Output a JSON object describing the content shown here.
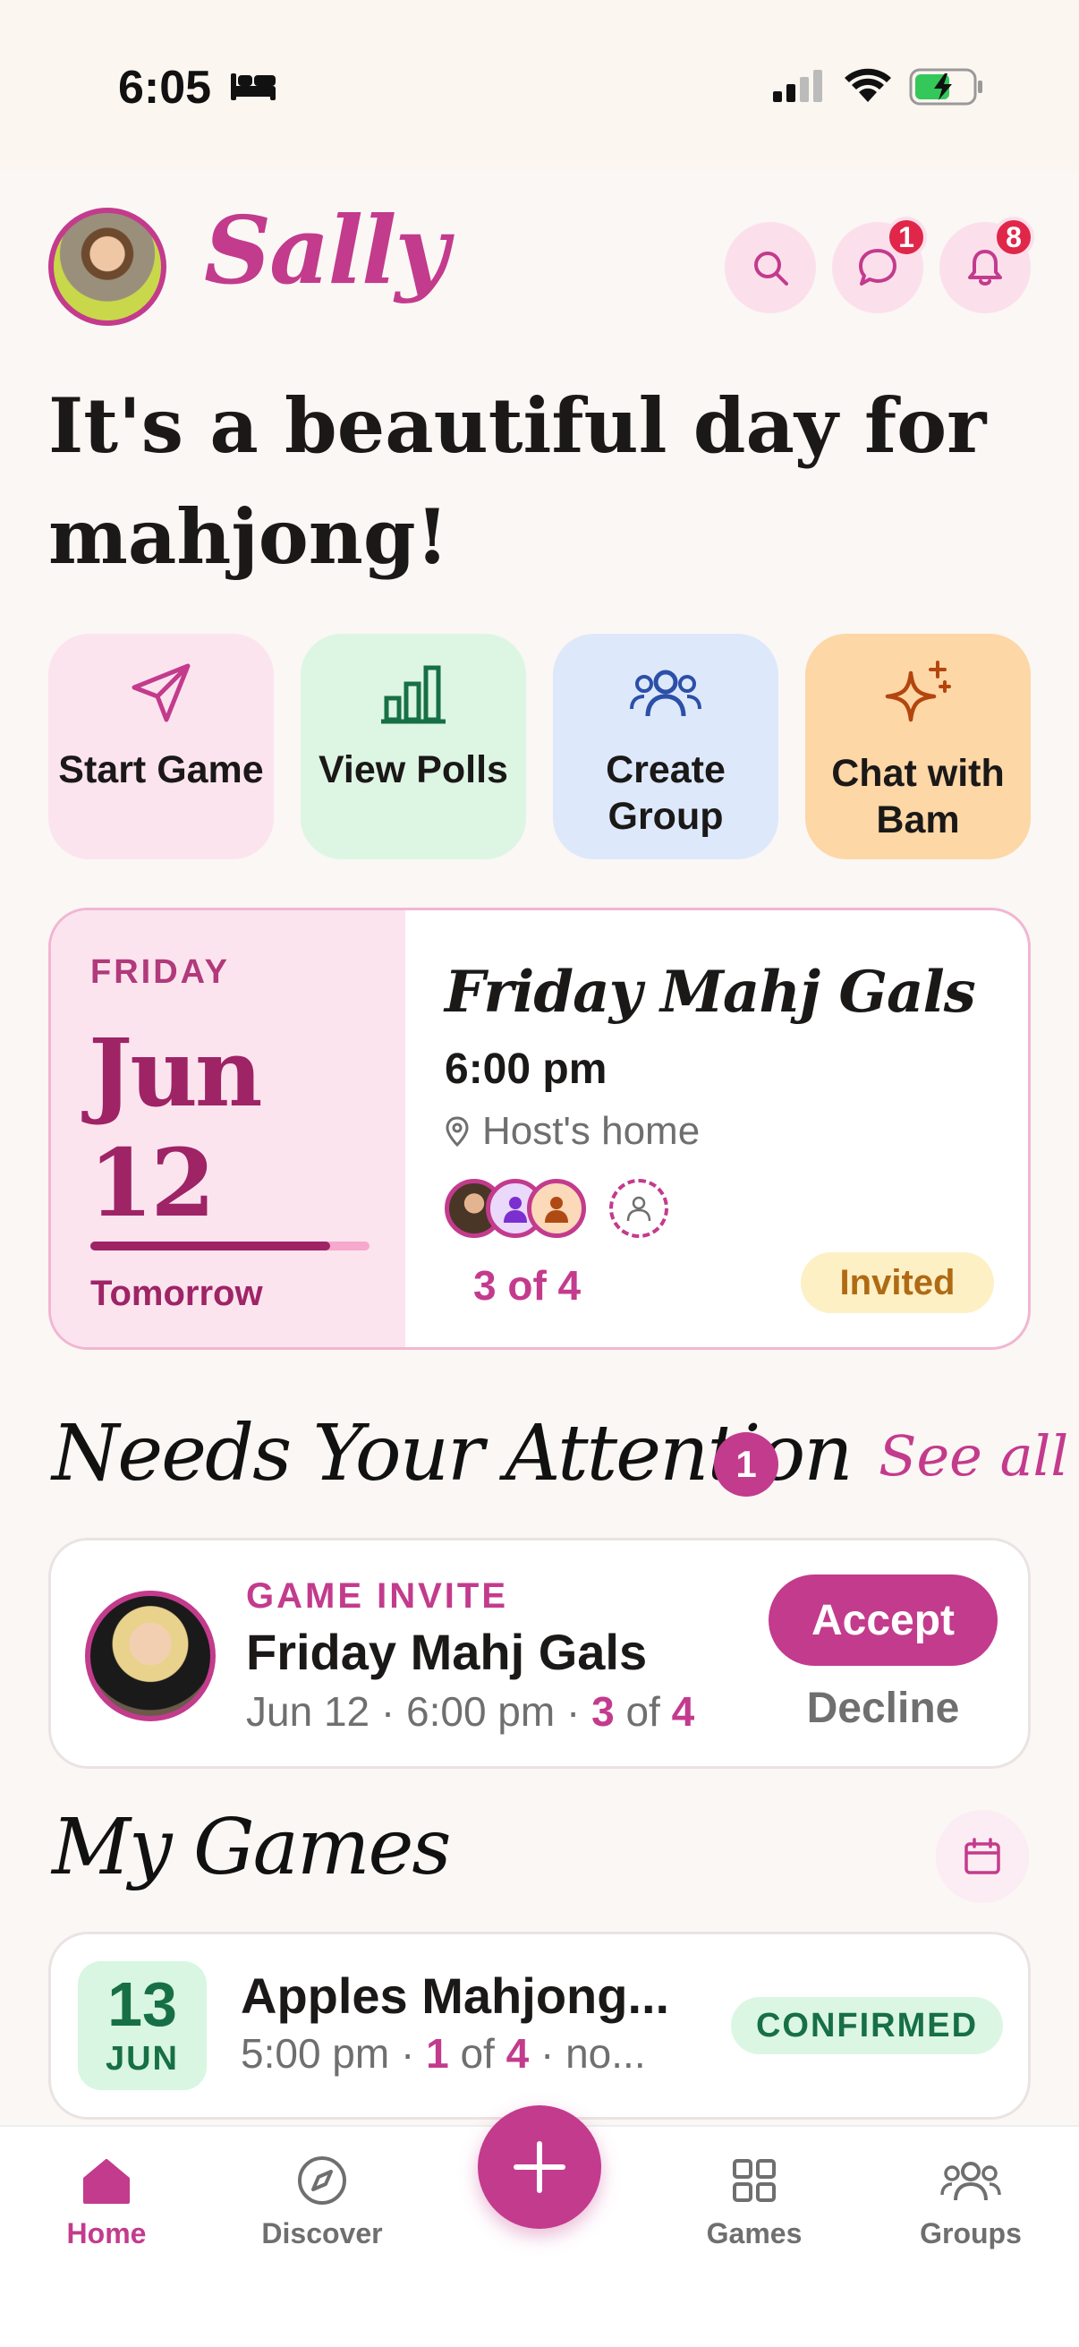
{
  "status_bar": {
    "time": "6:05"
  },
  "header": {
    "user_name": "Sally",
    "messages_badge": "1",
    "notifications_badge": "8"
  },
  "greeting": "It's a beautiful day for mahjong!",
  "quick_actions": [
    {
      "label": "Start Game",
      "icon": "send-icon",
      "bg": "#fce4ef",
      "color": "#c33b8d"
    },
    {
      "label": "View Polls",
      "icon": "bar-chart-icon",
      "bg": "#ddf6e4",
      "color": "#177045"
    },
    {
      "label": "Create Group",
      "icon": "users-icon",
      "bg": "#dde9fb",
      "color": "#2c4fa8"
    },
    {
      "label": "Chat with Bam",
      "icon": "sparkle-icon",
      "bg": "#fdd7a6",
      "color": "#b4450f"
    }
  ],
  "event": {
    "day": "FRIDAY",
    "date": "Jun 12",
    "relative": "Tomorrow",
    "progress": 0.86,
    "title": "Friday Mahj Gals",
    "time": "6:00 pm",
    "location": "Host's home",
    "count": "3 of 4",
    "status": "Invited"
  },
  "attention": {
    "title": "Needs Your Attention",
    "count": "1",
    "see_all": "See all",
    "item": {
      "type": "GAME INVITE",
      "title": "Friday Mahj Gals",
      "meta_prefix": "Jun 12 · 6:00 pm · ",
      "joined": "3",
      "of": " of ",
      "total": "4",
      "accept": "Accept",
      "decline": "Decline"
    }
  },
  "my_games": {
    "title": "My Games",
    "item": {
      "day": "13",
      "month": "JUN",
      "title": "Apples Mahjong...",
      "meta_prefix": "5:00 pm · ",
      "joined": "1",
      "of": " of ",
      "total": "4",
      "meta_suffix": " · no...",
      "status": "CONFIRMED"
    }
  },
  "tabs": [
    {
      "label": "Home",
      "icon": "home-icon",
      "active": true
    },
    {
      "label": "Discover",
      "icon": "compass-icon",
      "active": false
    },
    {
      "label": "Games",
      "icon": "grid-icon",
      "active": false
    },
    {
      "label": "Groups",
      "icon": "users-icon",
      "active": false
    }
  ]
}
